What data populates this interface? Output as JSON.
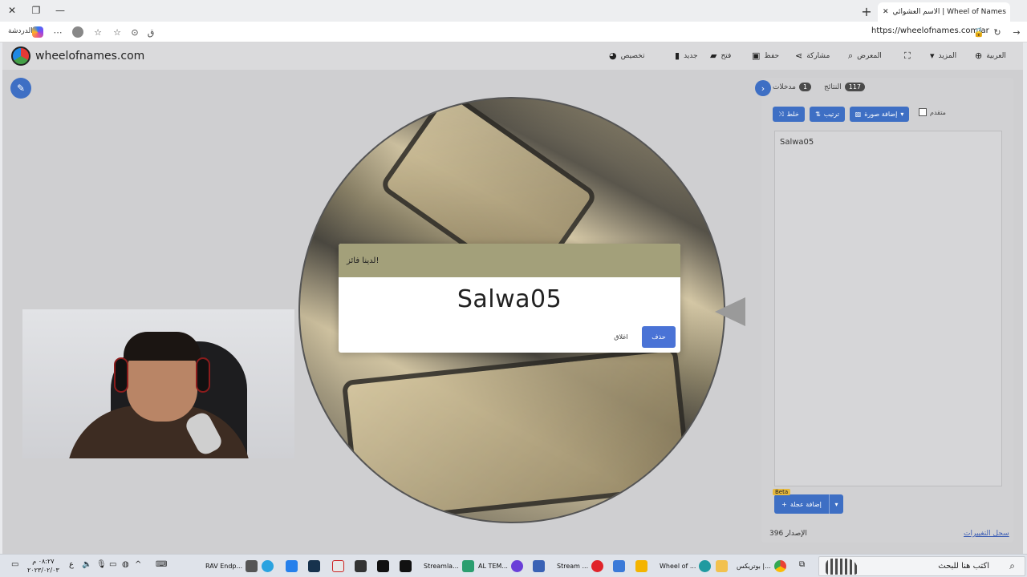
{
  "browser": {
    "tab_title": "الاسم العشوائي | Wheel of Names",
    "new_tab_label": "+",
    "url": "https://wheelofnames.com/ar",
    "bing_label": "الدردشة",
    "minimize": "—",
    "restore": "❐",
    "close": "✕"
  },
  "site": {
    "brand": "wheelofnames.com",
    "nav": {
      "customize": "تخصيص",
      "new": "جديد",
      "open": "فتح",
      "save": "حفظ",
      "share": "مشاركة",
      "gallery": "المعرض",
      "more": "المزيد",
      "language": "العربية"
    }
  },
  "panel": {
    "tab_entries": "مدخلات",
    "entries_count": "1",
    "tab_results": "النتائج",
    "results_count": "117",
    "shuffle": "خلط",
    "sort": "ترتيب",
    "add_image": "إضافة صورة",
    "advanced": "متقدم",
    "entries": [
      "Salwa05"
    ],
    "add_image_beta": "إضافة عجلة",
    "beta": "Beta",
    "version_label": "الإصدار 396",
    "changelog": "سجل التغييرات"
  },
  "dialog": {
    "header": "لدينا فائز!",
    "winner": "Salwa05",
    "remove": "حذف",
    "close": "اغلاق"
  },
  "taskbar": {
    "search_placeholder": "اكتب هنا للبحث",
    "apps": [
      "بوتريكس |...",
      "Wheel of ...",
      "Stream ...",
      "AL TEM...",
      "Streamla...",
      "RAV Endp..."
    ],
    "clock_time": "٠٨:٢٧ م",
    "clock_date": "٢٠٢٣/٠٢/٠٣",
    "lang": "ع"
  }
}
